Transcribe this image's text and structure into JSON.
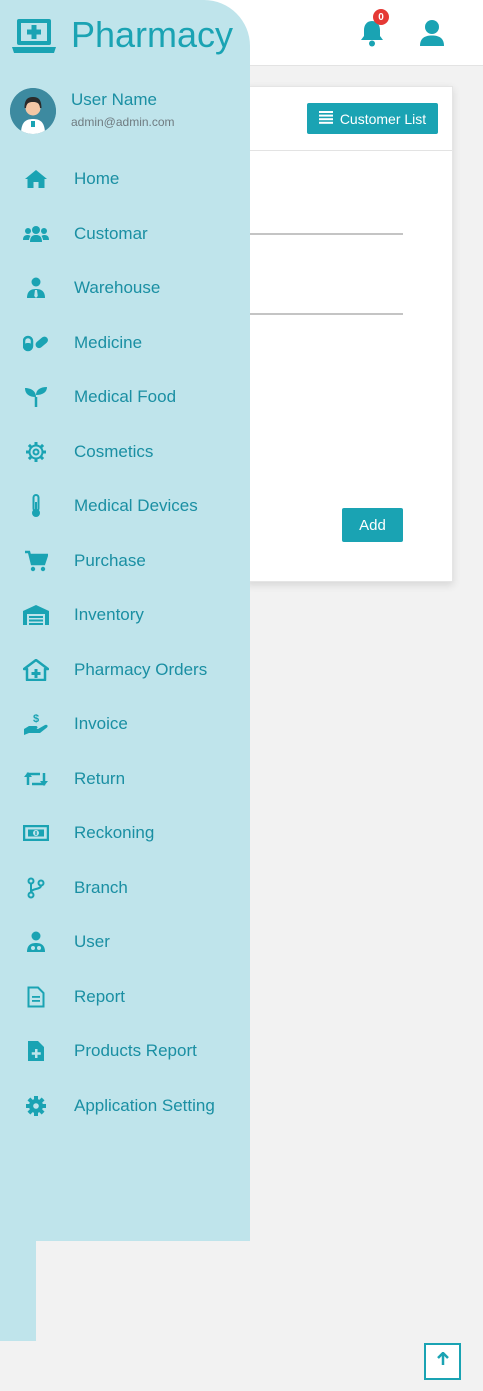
{
  "header": {
    "notification_count": "0",
    "icons": [
      "bell-icon",
      "user-icon"
    ]
  },
  "brand": {
    "title": "Pharmacy",
    "icon": "medical-laptop-icon"
  },
  "user": {
    "name": "User Name",
    "email": "admin@admin.com"
  },
  "menu": {
    "items": [
      {
        "label": "Home",
        "icon": "home-icon"
      },
      {
        "label": "Customar",
        "icon": "users-icon"
      },
      {
        "label": "Warehouse",
        "icon": "user-tie-icon"
      },
      {
        "label": "Medicine",
        "icon": "pills-icon"
      },
      {
        "label": "Medical Food",
        "icon": "seedling-icon"
      },
      {
        "label": "Cosmetics",
        "icon": "cog-icon"
      },
      {
        "label": "Medical Devices",
        "icon": "thermometer-icon"
      },
      {
        "label": "Purchase",
        "icon": "cart-icon"
      },
      {
        "label": "Inventory",
        "icon": "warehouse-icon"
      },
      {
        "label": "Pharmacy Orders",
        "icon": "clinic-icon"
      },
      {
        "label": "Invoice",
        "icon": "hand-dollar-icon"
      },
      {
        "label": "Return",
        "icon": "retweet-icon"
      },
      {
        "label": "Reckoning",
        "icon": "money-bill-icon"
      },
      {
        "label": "Branch",
        "icon": "code-branch-icon"
      },
      {
        "label": "User",
        "icon": "user-doctor-icon"
      },
      {
        "label": "Report",
        "icon": "file-text-icon"
      },
      {
        "label": "Products Report",
        "icon": "file-plus-icon"
      },
      {
        "label": "Application Setting",
        "icon": "settings-icon"
      }
    ]
  },
  "card": {
    "list_button": "Customer List",
    "add_button": "Add"
  },
  "colors": {
    "accent": "#1aa3b3",
    "sidebar_bg": "#bfe4eb",
    "badge": "#e53935",
    "page_bg": "#f2f2f2"
  }
}
